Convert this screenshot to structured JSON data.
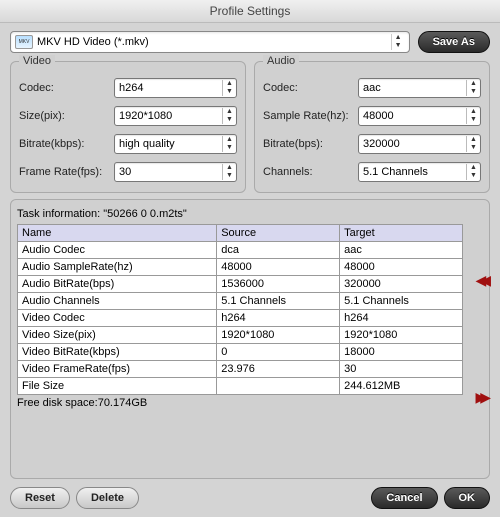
{
  "window": {
    "title": "Profile Settings"
  },
  "profile": {
    "label": "MKV HD Video (*.mkv)",
    "thumb": "MKV",
    "save_as": "Save As"
  },
  "video": {
    "title": "Video",
    "codec_label": "Codec:",
    "codec": "h264",
    "size_label": "Size(pix):",
    "size": "1920*1080",
    "bitrate_label": "Bitrate(kbps):",
    "bitrate": "high quality",
    "fps_label": "Frame Rate(fps):",
    "fps": "30"
  },
  "audio": {
    "title": "Audio",
    "codec_label": "Codec:",
    "codec": "aac",
    "sr_label": "Sample Rate(hz):",
    "sr": "48000",
    "bitrate_label": "Bitrate(bps):",
    "bitrate": "320000",
    "ch_label": "Channels:",
    "ch": "5.1 Channels"
  },
  "task": {
    "intro": "Task information: \"50266 0 0.m2ts\"",
    "headers": {
      "name": "Name",
      "source": "Source",
      "target": "Target"
    },
    "rows": [
      {
        "name": "Audio Codec",
        "source": "dca",
        "target": "aac"
      },
      {
        "name": "Audio SampleRate(hz)",
        "source": "48000",
        "target": "48000"
      },
      {
        "name": "Audio BitRate(bps)",
        "source": "1536000",
        "target": "320000"
      },
      {
        "name": "Audio Channels",
        "source": "5.1 Channels",
        "target": "5.1 Channels"
      },
      {
        "name": "Video Codec",
        "source": "h264",
        "target": "h264"
      },
      {
        "name": "Video Size(pix)",
        "source": "1920*1080",
        "target": "1920*1080"
      },
      {
        "name": "Video BitRate(kbps)",
        "source": "0",
        "target": "18000"
      },
      {
        "name": "Video FrameRate(fps)",
        "source": "23.976",
        "target": "30"
      },
      {
        "name": "File Size",
        "source": "",
        "target": "244.612MB"
      }
    ],
    "free_space": "Free disk space:70.174GB"
  },
  "footer": {
    "reset": "Reset",
    "delete": "Delete",
    "cancel": "Cancel",
    "ok": "OK"
  }
}
